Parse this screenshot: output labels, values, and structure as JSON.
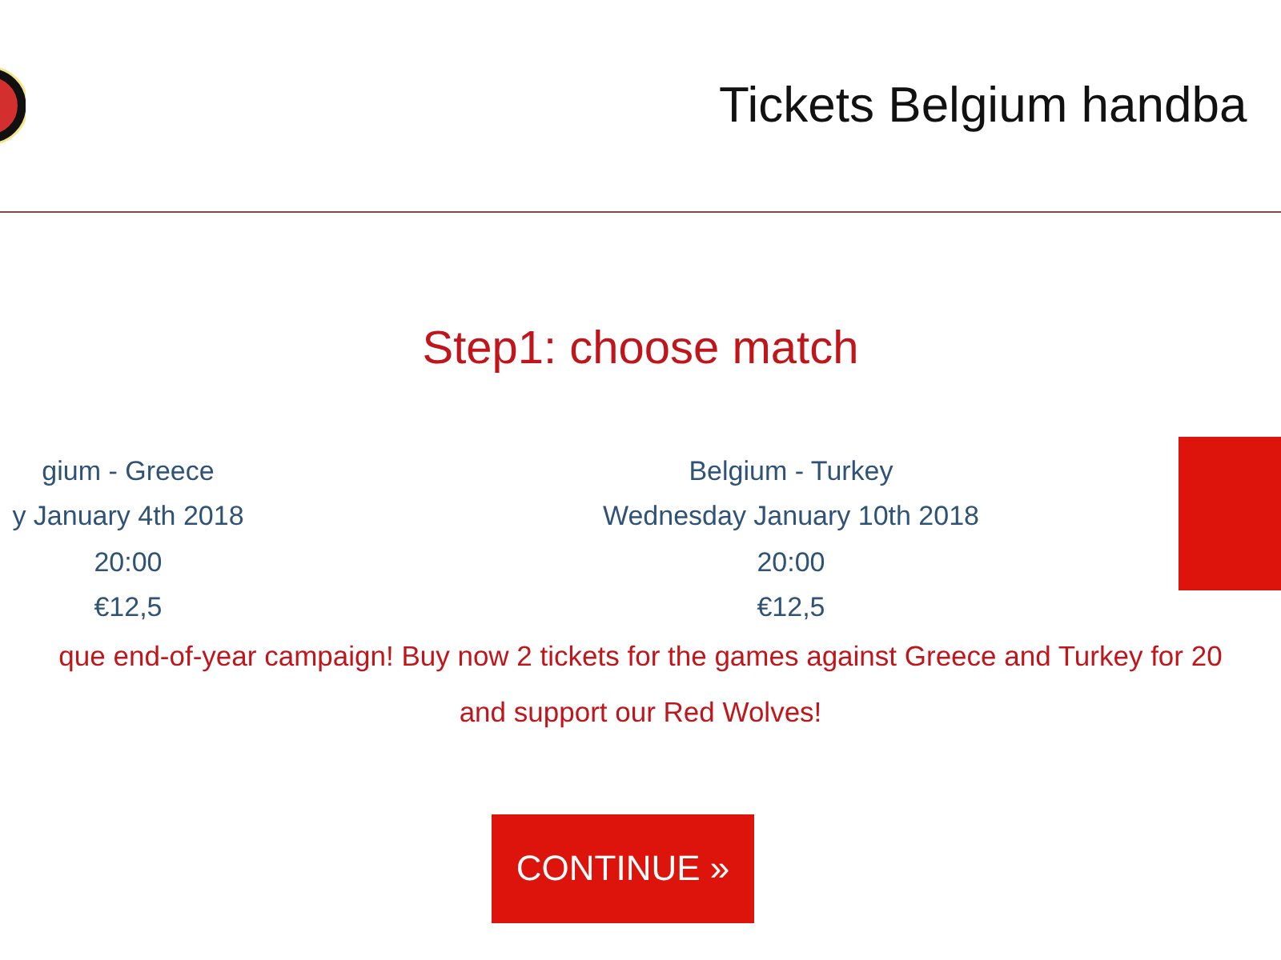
{
  "header": {
    "title": "Tickets Belgium handba"
  },
  "heading": "Step1: choose match",
  "matches": [
    {
      "teams": "gium - Greece",
      "date": "y January 4th 2018",
      "time": "20:00",
      "price": "€12,5",
      "selected": false
    },
    {
      "teams": "Belgium - Turkey",
      "date": "Wednesday January 10th 2018",
      "time": "20:00",
      "price": "€12,5",
      "selected": false
    },
    {
      "selected": true
    }
  ],
  "promo": [
    "que end-of-year campaign! Buy now 2 tickets for the games against Greece and Turkey for 20",
    "and support our Red Wolves!"
  ],
  "button": "CONTINUE »"
}
